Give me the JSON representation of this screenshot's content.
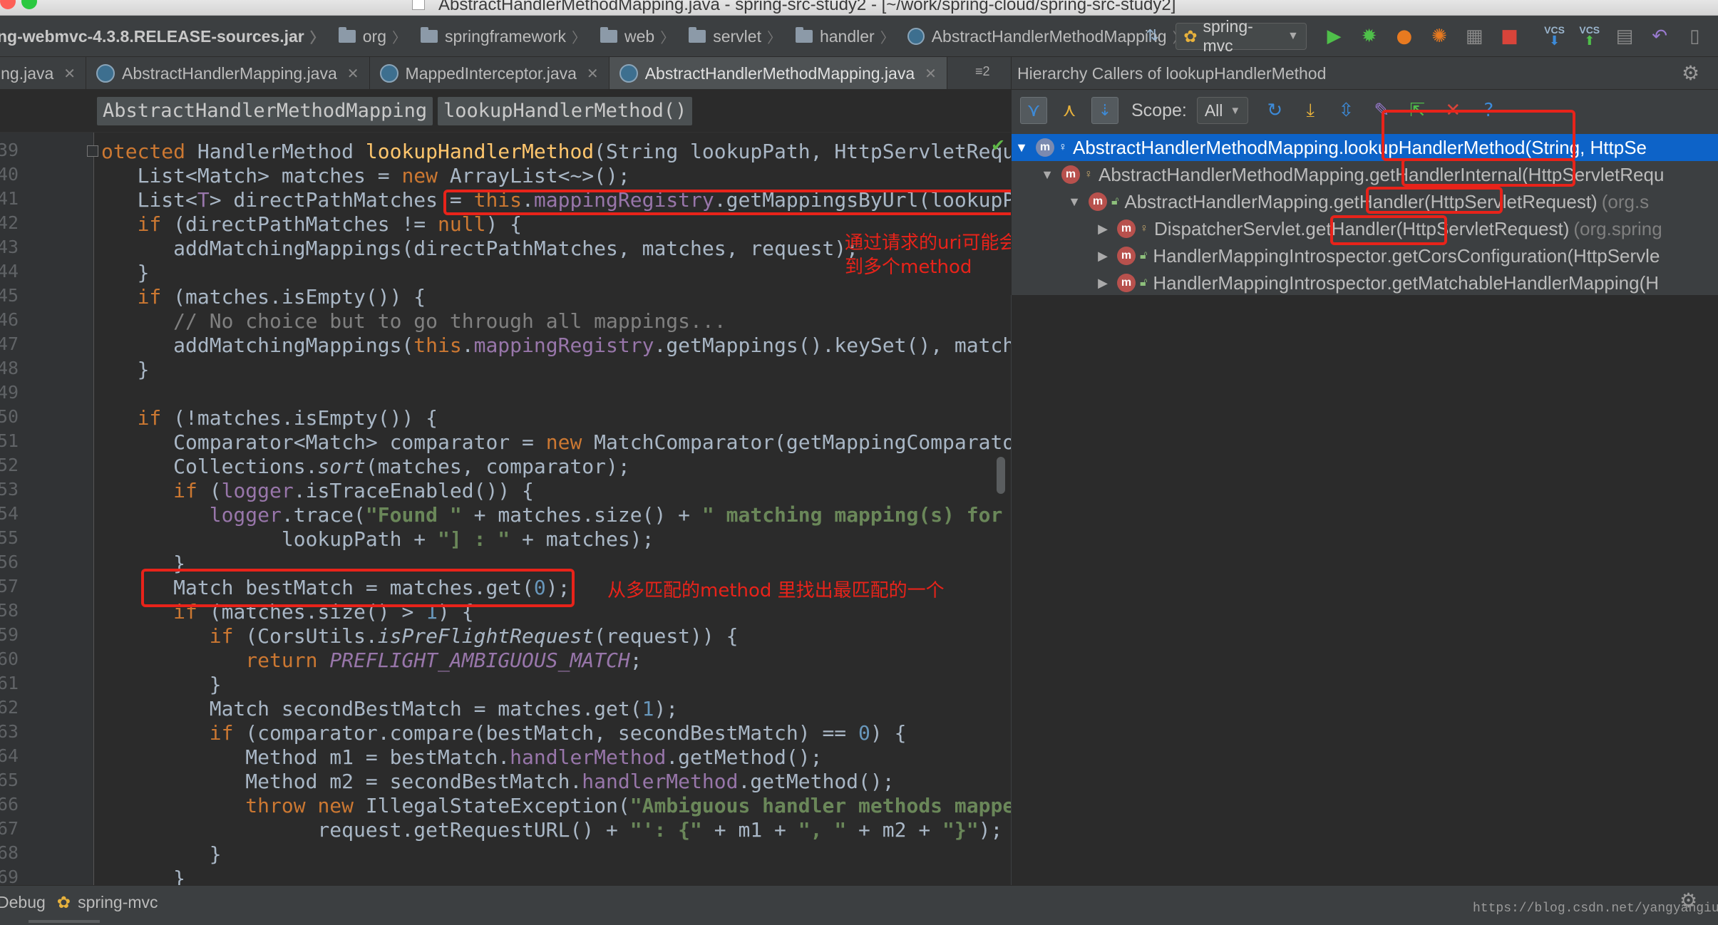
{
  "window": {
    "title": "AbstractHandlerMethodMapping.java - spring-src-study2 - [~/work/spring-cloud/spring-src-study2]"
  },
  "breadcrumbs": [
    {
      "label": "ng-webmvc-4.3.8.RELEASE-sources.jar",
      "icon": "jar"
    },
    {
      "label": "org",
      "icon": "folder-icon"
    },
    {
      "label": "springframework",
      "icon": "folder-icon"
    },
    {
      "label": "web",
      "icon": "folder-icon"
    },
    {
      "label": "servlet",
      "icon": "folder-icon"
    },
    {
      "label": "handler",
      "icon": "folder-icon"
    },
    {
      "label": "AbstractHandlerMethodMapping",
      "icon": "class-icon"
    }
  ],
  "toolbar": {
    "run_config": "spring-mvc",
    "vcs_label": "VCS"
  },
  "tabs": [
    {
      "label": "ing.java",
      "active": false
    },
    {
      "label": "AbstractHandlerMapping.java",
      "active": false
    },
    {
      "label": "MappedInterceptor.java",
      "active": false
    },
    {
      "label": "AbstractHandlerMethodMapping.java",
      "active": true
    }
  ],
  "tab_overflow": "≡2",
  "editor_breadcrumb": {
    "class_name": "AbstractHandlerMethodMapping",
    "method_name": "lookupHandlerMethod()"
  },
  "line_numbers": [
    "39",
    "40",
    "41",
    "42",
    "43",
    "44",
    "45",
    "46",
    "47",
    "48",
    "49",
    "50",
    "51",
    "52",
    "53",
    "54",
    "55",
    "56",
    "57",
    "58",
    "59",
    "60",
    "61",
    "62",
    "63",
    "64",
    "65",
    "66",
    "67",
    "68",
    "69"
  ],
  "hierarchy": {
    "title": "Hierarchy Callers of lookupHandlerMethod",
    "scope_label": "Scope:",
    "scope_value": "All",
    "rows": [
      {
        "arrow": "▼",
        "cls": "AbstractHandlerMethodMapping",
        "method": ".lookupHandlerMethod(String, HttpSe",
        "pkg": "",
        "selected": true
      },
      {
        "arrow": "▼",
        "cls": "AbstractHandlerMethodMapping",
        "method": ".getHandlerInternal(HttpServletRequ",
        "pkg": "",
        "selected": false
      },
      {
        "arrow": "▼",
        "cls": "AbstractHandlerMapping",
        "method": ".getHandler(HttpServletRequest)",
        "pkg": "(org.s",
        "selected": false
      },
      {
        "arrow": "▶",
        "cls": "DispatcherServlet",
        "method": ".getHandler(HttpServletRequest)",
        "pkg": "(org.spring",
        "selected": false
      },
      {
        "arrow": "▶",
        "cls": "HandlerMappingIntrospector",
        "method": ".getCorsConfiguration(HttpServle",
        "pkg": "",
        "selected": false
      },
      {
        "arrow": "▶",
        "cls": "HandlerMappingIntrospector",
        "method": ".getMatchableHandlerMapping(H",
        "pkg": "",
        "selected": false
      }
    ]
  },
  "annotations": {
    "note1_line1": "通过请求的uri可能会获取",
    "note1_line2": "到多个method",
    "note2": "从多匹配的method 里找出最匹配的一个"
  },
  "status": {
    "debug_label": "Debug",
    "debug_config": "spring-mvc",
    "watermark": "https://blog.csdn.net/yangyangiud"
  },
  "colors": {
    "annotation_red": "#e8231a",
    "selection_blue": "#0d63c8",
    "editor_bg": "#2b2b2b",
    "panel_bg": "#3c3f41"
  }
}
